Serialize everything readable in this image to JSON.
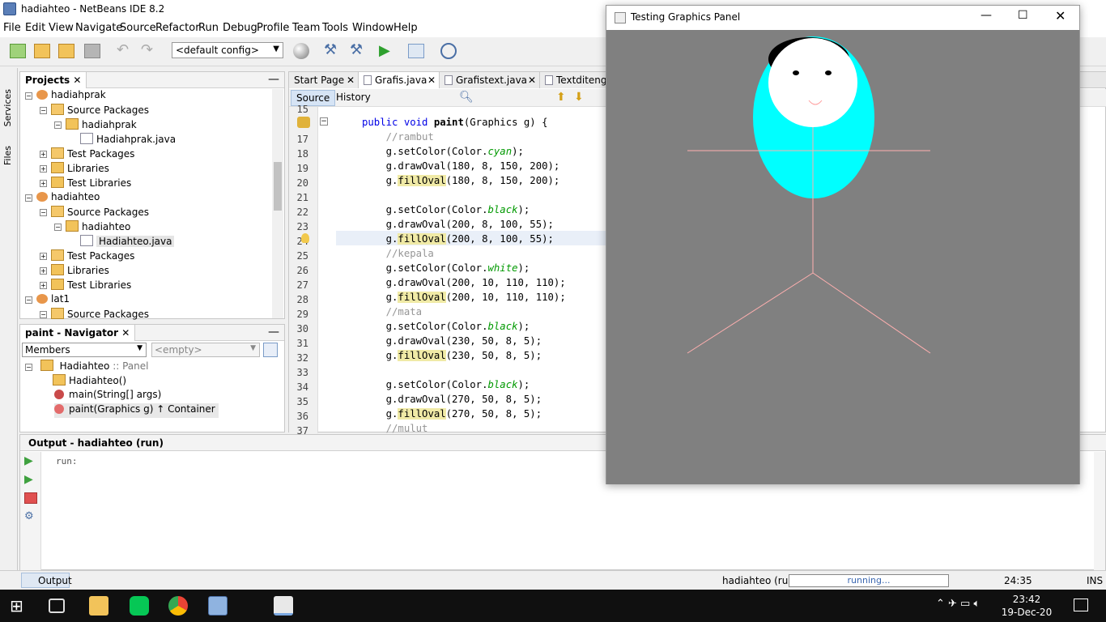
{
  "window": {
    "title": "hadiahteo - NetBeans IDE 8.2"
  },
  "menu": [
    "File",
    "Edit",
    "View",
    "Navigate",
    "Source",
    "Refactor",
    "Run",
    "Debug",
    "Profile",
    "Team",
    "Tools",
    "Window",
    "Help"
  ],
  "toolbar": {
    "config": "<default config>"
  },
  "left_strip": {
    "services": "Services",
    "files": "Files"
  },
  "projects": {
    "title": "Projects",
    "rows": [
      {
        "label": "hadiahprak",
        "kind": "proj"
      },
      {
        "label": "Source Packages",
        "kind": "pkgs"
      },
      {
        "label": "hadiahprak",
        "kind": "pkg"
      },
      {
        "label": "Hadiahprak.java",
        "kind": "java"
      },
      {
        "label": "Test Packages",
        "kind": "pkgs"
      },
      {
        "label": "Libraries",
        "kind": "lib"
      },
      {
        "label": "Test Libraries",
        "kind": "lib"
      },
      {
        "label": "hadiahteo",
        "kind": "proj"
      },
      {
        "label": "Source Packages",
        "kind": "pkgs"
      },
      {
        "label": "hadiahteo",
        "kind": "pkg"
      },
      {
        "label": "Hadiahteo.java",
        "kind": "java"
      },
      {
        "label": "Test Packages",
        "kind": "pkgs"
      },
      {
        "label": "Libraries",
        "kind": "lib"
      },
      {
        "label": "Test Libraries",
        "kind": "lib"
      },
      {
        "label": "lat1",
        "kind": "proj"
      },
      {
        "label": "Source Packages",
        "kind": "pkgs"
      }
    ]
  },
  "navigator": {
    "title": "paint - Navigator",
    "filter": "Members",
    "empty": "<empty>",
    "class_name": "Hadiahteo",
    "class_super": ":: Panel",
    "members": [
      "Hadiahteo()",
      "main(String[] args)",
      "paint(Graphics g) ↑ Container"
    ]
  },
  "editor": {
    "tabs": [
      "Start Page",
      "Grafis.java",
      "Grafistext.java",
      "Textditengah"
    ],
    "source": "Source",
    "history": "History",
    "first_line": "15",
    "lines": [
      {
        "n": "17",
        "t": "    //rambut"
      },
      {
        "n": "18",
        "t": "    g.setColor(Color.cyan);"
      },
      {
        "n": "19",
        "t": "    g.drawOval(180, 8, 150, 200);"
      },
      {
        "n": "20",
        "t": "    g.fillOval(180, 8, 150, 200);"
      },
      {
        "n": "21",
        "t": ""
      },
      {
        "n": "22",
        "t": "    g.setColor(Color.black);"
      },
      {
        "n": "23",
        "t": "    g.drawOval(200, 8, 100, 55);"
      },
      {
        "n": "24",
        "t": "    g.fillOval(200, 8, 100, 55);"
      },
      {
        "n": "25",
        "t": "    //kepala"
      },
      {
        "n": "26",
        "t": "    g.setColor(Color.white);"
      },
      {
        "n": "27",
        "t": "    g.drawOval(200, 10, 110, 110);"
      },
      {
        "n": "28",
        "t": "    g.fillOval(200, 10, 110, 110);"
      },
      {
        "n": "29",
        "t": "    //mata"
      },
      {
        "n": "30",
        "t": "    g.setColor(Color.black);"
      },
      {
        "n": "31",
        "t": "    g.drawOval(230, 50, 8, 5);"
      },
      {
        "n": "32",
        "t": "    g.fillOval(230, 50, 8, 5);"
      },
      {
        "n": "33",
        "t": ""
      },
      {
        "n": "34",
        "t": "    g.setColor(Color.black);"
      },
      {
        "n": "35",
        "t": "    g.drawOval(270, 50, 8, 5);"
      },
      {
        "n": "36",
        "t": "    g.fillOval(270, 50, 8, 5);"
      },
      {
        "n": "37",
        "t": "    //mulut"
      }
    ],
    "method_line": "public void paint(Graphics g) {"
  },
  "output": {
    "title": "Output - hadiahteo (run)",
    "text": "run:",
    "tab": "Output"
  },
  "status": {
    "project": "hadiahteo (run)",
    "progress": "running...",
    "position": "24:35",
    "mode": "INS"
  },
  "graphics_window": {
    "title": "Testing Graphics Panel"
  },
  "taskbar": {
    "time": "23:42",
    "date": "19-Dec-20"
  }
}
